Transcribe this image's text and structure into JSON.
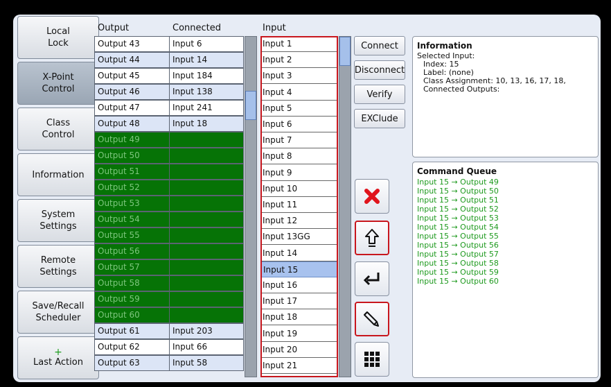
{
  "sidebar": {
    "items": [
      {
        "label": "Local\nLock"
      },
      {
        "label": "X-Point\nControl"
      },
      {
        "label": "Class\nControl"
      },
      {
        "label": "Information"
      },
      {
        "label": "System\nSettings"
      },
      {
        "label": "Remote\nSettings"
      },
      {
        "label": "Save/Recall\nScheduler"
      },
      {
        "label": "Last Action",
        "icon": "+"
      }
    ]
  },
  "headers": {
    "output": "Output",
    "connected": "Connected",
    "input": "Input"
  },
  "outputs": [
    {
      "output": "Output 43",
      "connected": "Input 6",
      "state": "white"
    },
    {
      "output": "Output 44",
      "connected": "Input 14",
      "state": "blue"
    },
    {
      "output": "Output 45",
      "connected": "Input 184",
      "state": "white"
    },
    {
      "output": "Output 46",
      "connected": "Input 138",
      "state": "blue"
    },
    {
      "output": "Output 47",
      "connected": "Input 241",
      "state": "white"
    },
    {
      "output": "Output 48",
      "connected": "Input 18",
      "state": "blue"
    },
    {
      "output": "Output 49",
      "connected": "",
      "state": "green"
    },
    {
      "output": "Output 50",
      "connected": "",
      "state": "green"
    },
    {
      "output": "Output 51",
      "connected": "",
      "state": "green"
    },
    {
      "output": "Output 52",
      "connected": "",
      "state": "green"
    },
    {
      "output": "Output 53",
      "connected": "",
      "state": "green"
    },
    {
      "output": "Output 54",
      "connected": "",
      "state": "green"
    },
    {
      "output": "Output 55",
      "connected": "",
      "state": "green"
    },
    {
      "output": "Output 56",
      "connected": "",
      "state": "green"
    },
    {
      "output": "Output 57",
      "connected": "",
      "state": "green"
    },
    {
      "output": "Output 58",
      "connected": "",
      "state": "green"
    },
    {
      "output": "Output 59",
      "connected": "",
      "state": "green"
    },
    {
      "output": "Output 60",
      "connected": "",
      "state": "green"
    },
    {
      "output": "Output 61",
      "connected": "Input 203",
      "state": "blue"
    },
    {
      "output": "Output 62",
      "connected": "Input 66",
      "state": "white"
    },
    {
      "output": "Output 63",
      "connected": "Input 58",
      "state": "blue"
    }
  ],
  "inputs": [
    "Input 1",
    "Input 2",
    "Input 3",
    "Input 4",
    "Input 5",
    "Input 6",
    "Input 7",
    "Input 8",
    "Input 9",
    "Input 10",
    "Input 11",
    "Input 12",
    "Input 13GG",
    "Input 14",
    "Input 15",
    "Input 16",
    "Input 17",
    "Input 18",
    "Input 19",
    "Input 20",
    "Input 21"
  ],
  "selected_input_index": 14,
  "actions": {
    "connect": "Connect",
    "disconnect": "Disconnect",
    "verify": "Verify",
    "exclude": "EXClude"
  },
  "information": {
    "title": "Information",
    "lines": [
      "Selected Input:",
      "  Index: 15",
      "  Label: (none)",
      "  Class Assignment: 10, 13, 16, 17, 18,",
      "  Connected Outputs:"
    ]
  },
  "command_queue": {
    "title": "Command Queue",
    "items": [
      "Input 15 → Output 49",
      "Input 15 → Output 50",
      "Input 15 → Output 51",
      "Input 15 → Output 52",
      "Input 15 → Output 53",
      "Input 15 → Output 54",
      "Input 15 → Output 55",
      "Input 15 → Output 56",
      "Input 15 → Output 57",
      "Input 15 → Output 58",
      "Input 15 → Output 59",
      "Input 15 → Output 60"
    ]
  },
  "colors": {
    "green_row": "#067306",
    "selected_row": "#a8c2ee",
    "alert_red": "#c8161d",
    "queue_text": "#1e9a1e"
  }
}
